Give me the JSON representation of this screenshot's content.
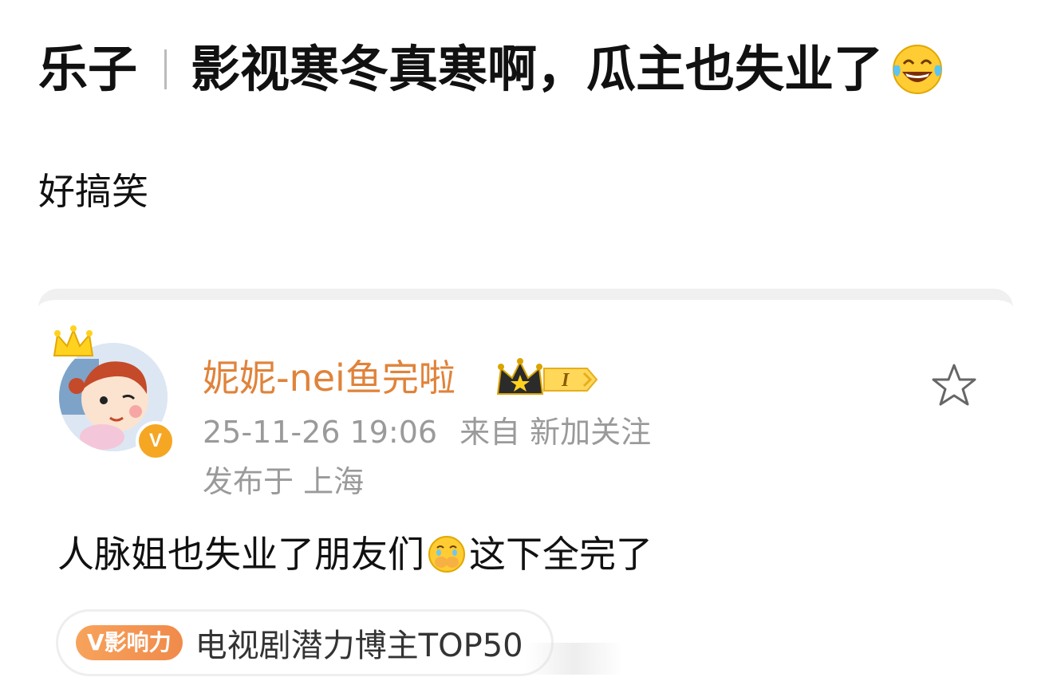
{
  "post": {
    "title_prefix": "乐子",
    "title_main": "影视寒冬真寒啊，瓜主也失业了",
    "title_emoji": "laughing-tears-icon",
    "body": "好搞笑"
  },
  "comment": {
    "username": "妮妮-nei鱼完啦",
    "level_badge_text": "I",
    "timestamp": "25-11-26 19:06",
    "source": "来自 新加关注",
    "location": "发布于 上海",
    "text_before": "人脉姐也失业了朋友们",
    "text_emoji": "covering-mouth-icon",
    "text_after": "这下全完了",
    "verified_mark": "V",
    "influence_tag": "V影响力",
    "influence_text": "电视剧潜力博主TOP50"
  },
  "colors": {
    "username": "#e0833a",
    "meta": "#9a9a9a",
    "badge_orange": "#f5a623"
  }
}
